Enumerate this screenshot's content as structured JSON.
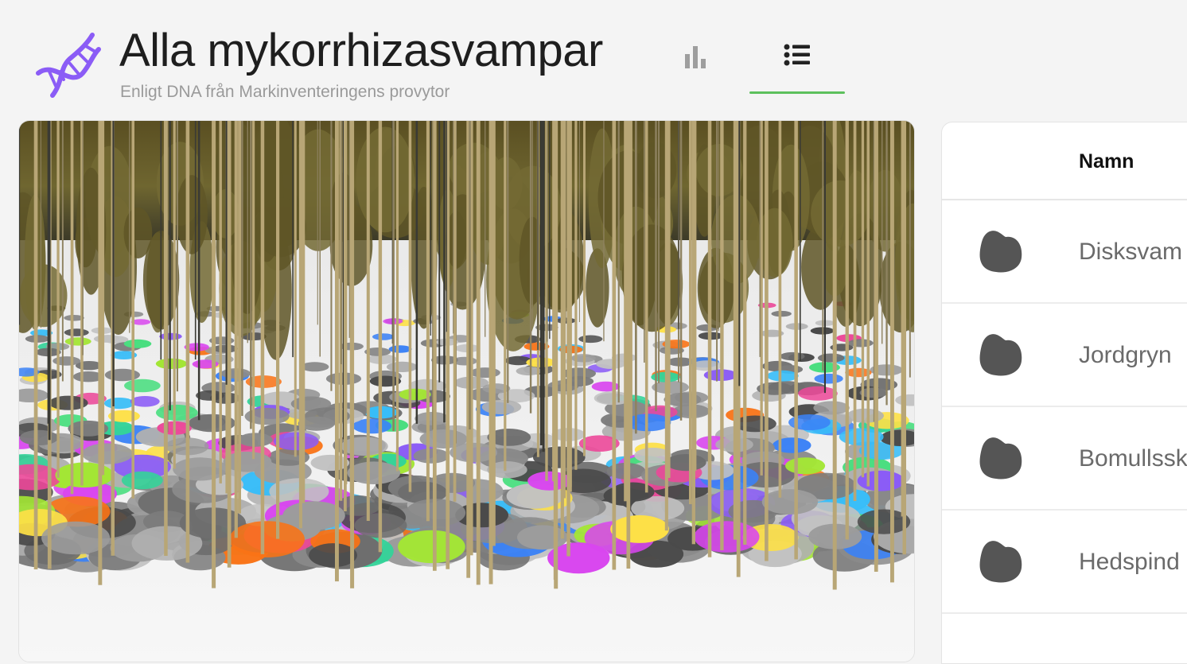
{
  "header": {
    "title": "Alla mykorrhizasvampar",
    "subtitle": "Enligt DNA från Markinventeringens provytor",
    "logo_icon": "dna-icon",
    "logo_color": "#8b5cf6",
    "views": [
      {
        "icon": "bar-chart-icon",
        "active": false
      },
      {
        "icon": "list-icon",
        "active": true
      }
    ],
    "active_indicator_color": "#5cc05c"
  },
  "scene": {
    "icon": "forest-scene-image",
    "patch_colors": [
      "#d946ef",
      "#a3e635",
      "#38bdf8",
      "#fde047",
      "#8b5cf6",
      "#34d399",
      "#f97316",
      "#ec4899",
      "#4ade80",
      "#3b82f6"
    ]
  },
  "table": {
    "columns": {
      "name": "Namn"
    },
    "rows": [
      {
        "name": "Disksvam",
        "icon": "fungus-blob-icon"
      },
      {
        "name": "Jordgryn",
        "icon": "fungus-blob-icon"
      },
      {
        "name": "Bomullssk",
        "icon": "fungus-blob-icon"
      },
      {
        "name": "Hedspind",
        "icon": "fungus-blob-icon"
      }
    ],
    "blob_color": "#555555"
  }
}
